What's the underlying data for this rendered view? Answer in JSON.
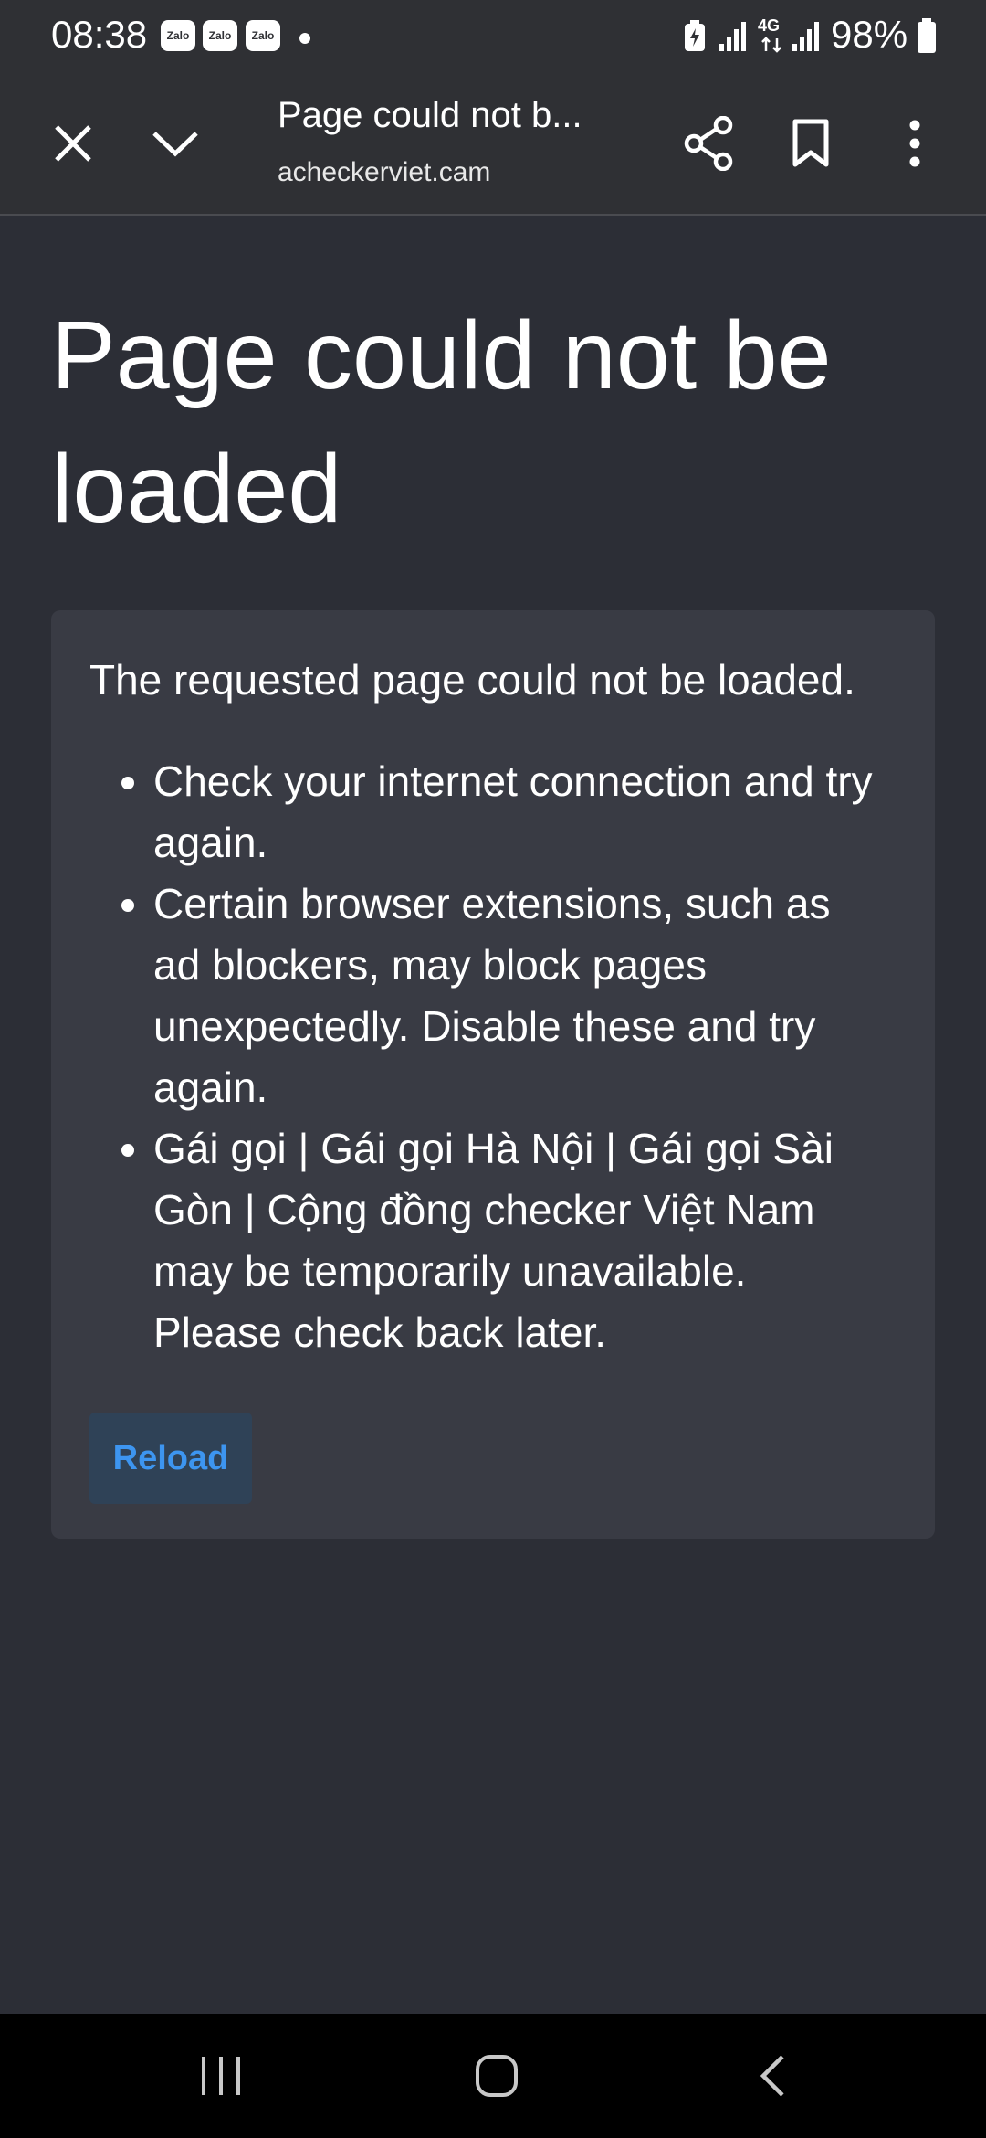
{
  "status_bar": {
    "time": "08:38",
    "notifications": [
      "Zalo",
      "Zalo",
      "Zalo"
    ],
    "network": "4G",
    "battery": "98%"
  },
  "toolbar": {
    "page_title": "Page could not b...",
    "url": "acheckerviet.cam",
    "icons": [
      "close-icon",
      "chevron-down-icon",
      "share-icon",
      "bookmark-icon",
      "more-vert-icon"
    ]
  },
  "content": {
    "title": "Page could not be loaded",
    "intro": "The requested page could not be loaded.",
    "bullets": [
      "Check your internet connection and try again.",
      "Certain browser extensions, such as ad blockers, may block pages unexpectedly. Disable these and try again.",
      "Gái gọi | Gái gọi Hà Nội | Gái gọi Sài Gòn | Cộng đồng checker Việt Nam may be temporarily unavailable. Please check back later."
    ],
    "reload_label": "Reload"
  },
  "nav_bar": {
    "icons": [
      "recent-apps-icon",
      "home-icon",
      "back-icon"
    ]
  },
  "colors": {
    "background": "#2c2e36",
    "card": "#393b44",
    "toolbar": "#2f3034",
    "accent": "#3d95f0",
    "button_bg": "#2f4257"
  }
}
